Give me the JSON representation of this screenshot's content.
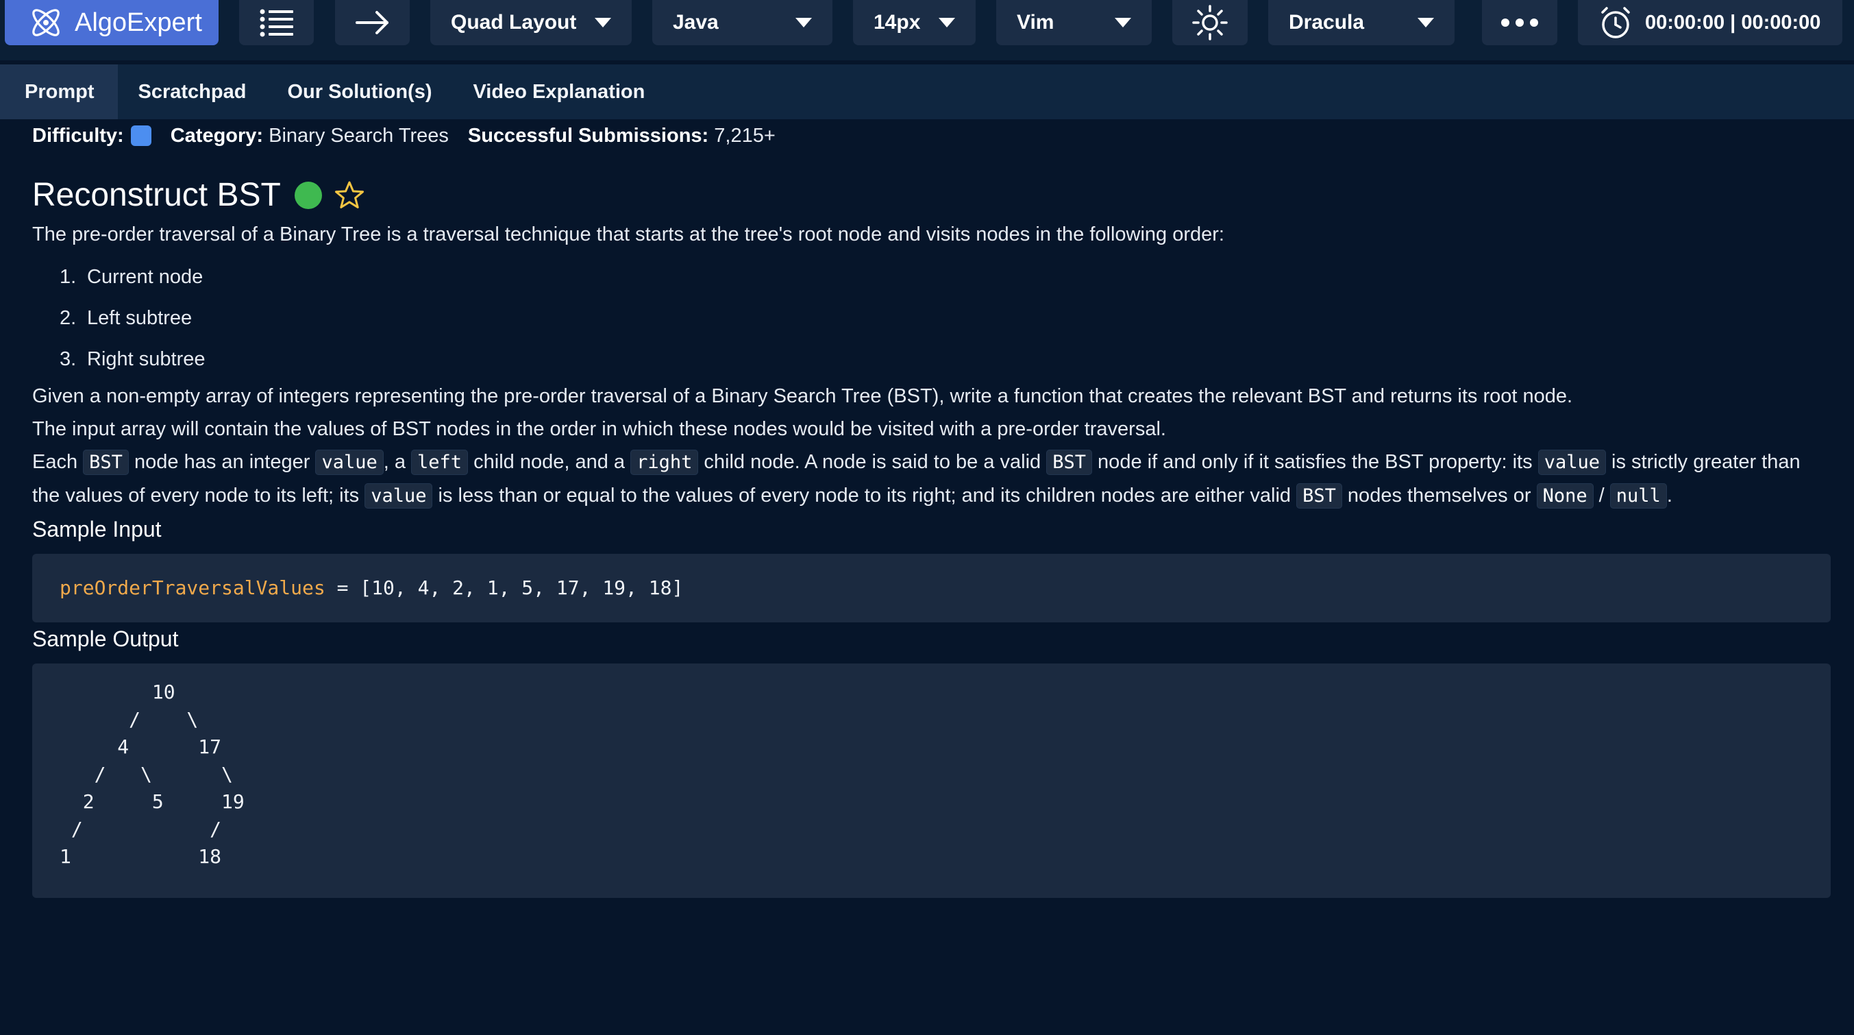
{
  "toolbar": {
    "brand": "AlgoExpert",
    "layout_label": "Quad Layout",
    "language_label": "Java",
    "font_size_label": "14px",
    "keymap_label": "Vim",
    "theme_label": "Dracula",
    "timer": "00:00:00 | 00:00:00",
    "icons": [
      "algoexpert-logo-icon",
      "list-icon",
      "arrow-right-icon",
      "sun-icon",
      "more-dots-icon",
      "stopwatch-icon"
    ]
  },
  "tabs": [
    {
      "label": "Prompt",
      "active": true
    },
    {
      "label": "Scratchpad",
      "active": false
    },
    {
      "label": "Our Solution(s)",
      "active": false
    },
    {
      "label": "Video Explanation",
      "active": false
    }
  ],
  "meta": {
    "difficulty_label": "Difficulty:",
    "category_label": "Category:",
    "category_value": "Binary Search Trees",
    "submissions_label": "Successful Submissions:",
    "submissions_value": "7,215+"
  },
  "problem": {
    "title": "Reconstruct BST",
    "intro": "The pre-order traversal of a Binary Tree is a traversal technique that starts at the tree's root node and visits nodes in the following order:",
    "steps": [
      "Current node",
      "Left subtree",
      "Right subtree"
    ],
    "step_numbers": [
      "1.",
      "2.",
      "3."
    ],
    "para2": "Given a non-empty array of integers representing the pre-order traversal of a Binary Search Tree (BST), write a function that creates the relevant BST and returns its root node.",
    "para3": "The input array will contain the values of BST nodes in the order in which these nodes would be visited with a pre-order traversal.",
    "para4": {
      "t1": "Each ",
      "c1": "BST",
      "t2": " node has an integer ",
      "c2": "value",
      "t3": ", a ",
      "c3": "left",
      "t4": " child node, and a ",
      "c4": "right",
      "t5": " child node. A node is said to be a valid ",
      "c5": "BST",
      "t6": " node if and only if it satisfies the BST property: its ",
      "c6": "value",
      "t7": " is strictly greater than the values of every node to its left; its ",
      "c7": "value",
      "t8": " is less than or equal to the values of every node to its right; and its children nodes are either valid ",
      "c8": "BST",
      "t9": " nodes themselves or ",
      "c9": "None",
      "t10": " / ",
      "c10": "null",
      "t11": "."
    }
  },
  "sample_input": {
    "heading": "Sample Input",
    "var_name": "preOrderTraversalValues",
    "rest": " = [10, 4, 2, 1, 5, 17, 19, 18]"
  },
  "sample_output": {
    "heading": "Sample Output",
    "tree": "        10\n      /    \\\n     4      17\n   /   \\      \\\n  2     5     19\n /           /\n1           18"
  },
  "colors": {
    "background": "#06152a",
    "toolbar_button": "#1b2d46",
    "brand": "#4a6fd6",
    "difficulty_square": "#4c8ef0",
    "completed_dot": "#3fb950",
    "code_variable": "#f0a94b"
  }
}
